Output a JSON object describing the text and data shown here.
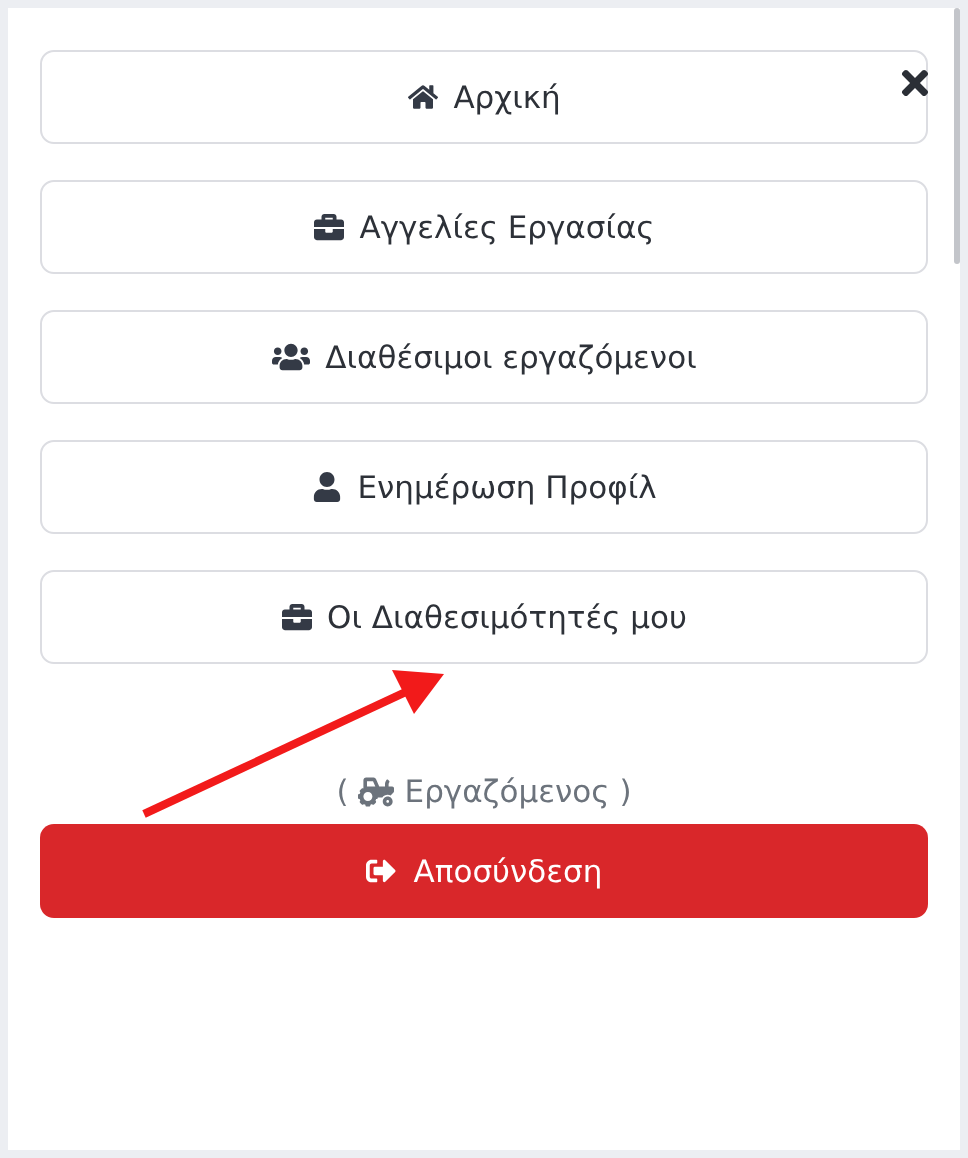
{
  "menu": [
    {
      "label": "Αρχική"
    },
    {
      "label": "Αγγελίες Εργασίας"
    },
    {
      "label": "Διαθέσιμοι εργαζόμενοι"
    },
    {
      "label": "Ενημέρωση Προφίλ"
    },
    {
      "label": "Οι Διαθεσιμότητές μου"
    }
  ],
  "role": {
    "open": "(",
    "label": "Εργαζόμενος",
    "close": ")"
  },
  "logout": {
    "label": "Αποσύνδεση"
  }
}
